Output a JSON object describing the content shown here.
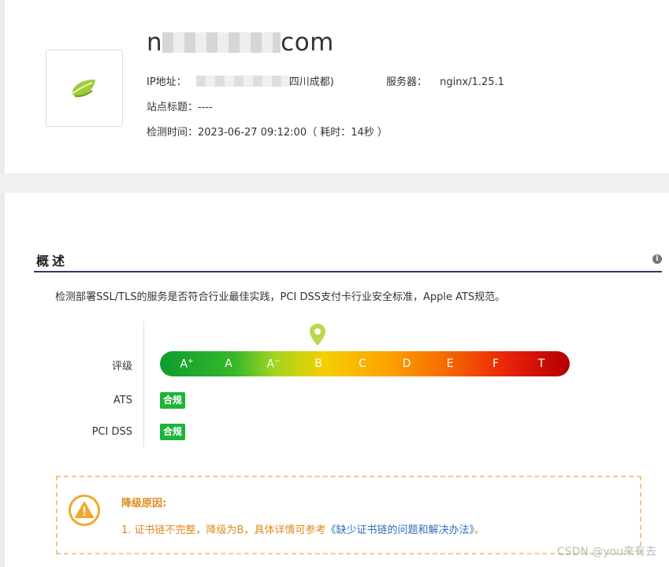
{
  "site": {
    "domain_prefix": "n",
    "domain_suffix": "com",
    "ip_label": "IP地址：",
    "ip_location": "四川成都)",
    "server_label": "服务器：",
    "server_value": "nginx/1.25.1",
    "site_title_label": "站点标题：",
    "site_title_value": "----",
    "check_time_label": "检测时间：",
    "check_time_value": "2023-06-27 09:12:00",
    "duration_text": "（ 耗时：14秒 ）",
    "logo_icon": "leaf-icon"
  },
  "overview": {
    "title": "概述",
    "description": "检测部署SSL/TLS的服务是否符合行业最佳实践，PCI DSS支付卡行业安全标准，Apple ATS规范。",
    "rating_label": "评级",
    "grades": [
      "A+",
      "A",
      "A-",
      "B",
      "C",
      "D",
      "E",
      "F",
      "T"
    ],
    "current_grade": "B",
    "ats_label": "ATS",
    "ats_status": "合规",
    "pci_label": "PCI DSS",
    "pci_status": "合规"
  },
  "notice": {
    "title": "降级原因:",
    "item_prefix": "1. 证书链不完整，降级为B，具体详情可参考",
    "item_link": "《缺少证书链的问题和解决办法》",
    "item_suffix": "。"
  },
  "watermark": "CSDN @you来有去",
  "colors": {
    "section_rule": "#2c3e6b",
    "badge_green": "#1fb33a",
    "notice_orange": "#e08a1c",
    "link_blue": "#2f6fb5"
  }
}
